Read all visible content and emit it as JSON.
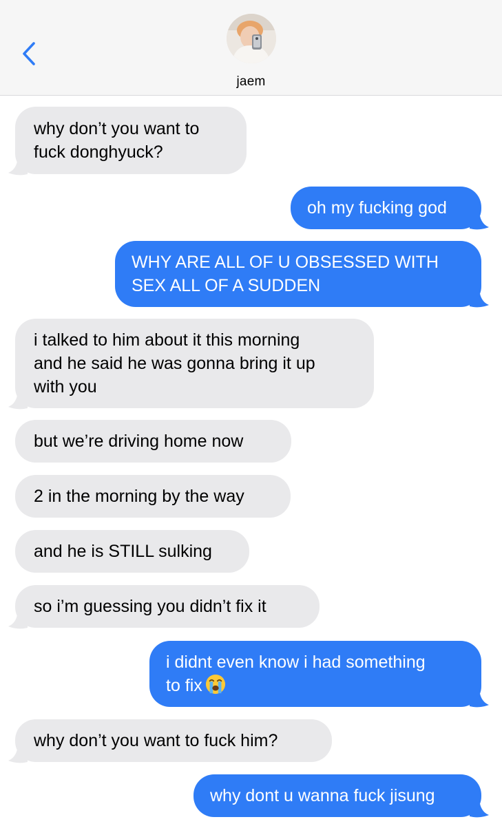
{
  "header": {
    "contact_name": "jaem",
    "back_icon": "chevron-left-icon",
    "accent_color": "#2f7cf6"
  },
  "colors": {
    "incoming_bubble": "#e9e9eb",
    "outgoing_bubble": "#2f7cf6"
  },
  "messages": [
    {
      "direction": "incoming",
      "text": "why don’t you want to\nfuck donghyuck?"
    },
    {
      "direction": "outgoing",
      "text": "oh my fucking god"
    },
    {
      "direction": "outgoing",
      "text": "WHY ARE ALL OF U OBSESSED WITH\nSEX ALL OF A SUDDEN"
    },
    {
      "direction": "incoming",
      "text": "i talked to him about it this morning\nand he said he was gonna bring it up\nwith you"
    },
    {
      "direction": "incoming",
      "text": "but we’re driving home now"
    },
    {
      "direction": "incoming",
      "text": "2 in the morning by the way"
    },
    {
      "direction": "incoming",
      "text": "and he is STILL sulking"
    },
    {
      "direction": "incoming",
      "text": "so i’m guessing you didn’t fix it"
    },
    {
      "direction": "outgoing",
      "text": "i didnt even know i had something\nto fix",
      "emoji": "loudly-crying-face-emoji"
    },
    {
      "direction": "incoming",
      "text": "why don’t you want to fuck him?"
    },
    {
      "direction": "outgoing",
      "text": "why dont u wanna fuck jisung"
    }
  ]
}
